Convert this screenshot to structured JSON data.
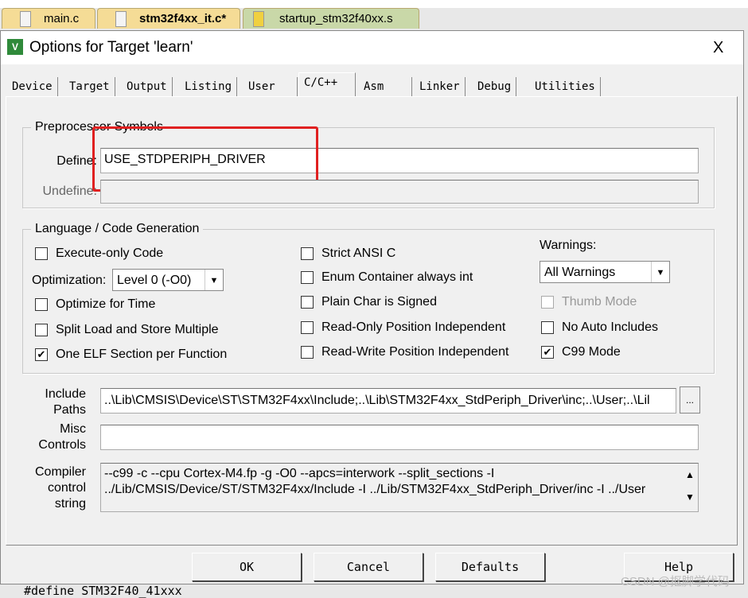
{
  "file_tabs": [
    {
      "label": "main.c",
      "color": "#f5dc96"
    },
    {
      "label": "stm32f4xx_it.c*",
      "color": "#f5dc96"
    },
    {
      "label": "startup_stm32f40xx.s",
      "color": "#c9d8a8"
    }
  ],
  "dialog": {
    "title": "Options for Target 'learn'",
    "close": "X"
  },
  "tabs": [
    "Device",
    "Target",
    "Output",
    "Listing",
    "User",
    "C/C++",
    "Asm",
    "Linker",
    "Debug",
    "Utilities"
  ],
  "active_tab": "C/C++",
  "preprocessor": {
    "legend": "Preprocessor Symbols",
    "define_label": "Define:",
    "define_value": "USE_STDPERIPH_DRIVER",
    "undefine_label": "Undefine:",
    "undefine_value": "",
    "highlight_color": "#e02020"
  },
  "codegen": {
    "legend": "Language / Code Generation",
    "execute_only": {
      "label": "Execute-only Code",
      "checked": false
    },
    "optimization_label": "Optimization:",
    "optimization_value": "Level 0 (-O0)",
    "optimize_time": {
      "label": "Optimize for Time",
      "checked": false
    },
    "split_load": {
      "label": "Split Load and Store Multiple",
      "checked": false
    },
    "one_elf": {
      "label": "One ELF Section per Function",
      "checked": true
    },
    "strict_ansi": {
      "label": "Strict ANSI C",
      "checked": false
    },
    "enum_container": {
      "label": "Enum Container always int",
      "checked": false
    },
    "plain_char": {
      "label": "Plain Char is Signed",
      "checked": false
    },
    "ro_pi": {
      "label": "Read-Only Position Independent",
      "checked": false
    },
    "rw_pi": {
      "label": "Read-Write Position Independent",
      "checked": false
    },
    "warnings_label": "Warnings:",
    "warnings_value": "All Warnings",
    "thumb_mode": {
      "label": "Thumb Mode",
      "checked": false,
      "disabled": true
    },
    "no_auto_includes": {
      "label": "No Auto Includes",
      "checked": false
    },
    "c99": {
      "label": "C99 Mode",
      "checked": true
    }
  },
  "include_paths": {
    "label1": "Include",
    "label2": "Paths",
    "value": "..\\Lib\\CMSIS\\Device\\ST\\STM32F4xx\\Include;..\\Lib\\STM32F4xx_StdPeriph_Driver\\inc;..\\User;..\\Lil",
    "browse": "..."
  },
  "misc_controls": {
    "label1": "Misc",
    "label2": "Controls",
    "value": ""
  },
  "compiler_string": {
    "label1": "Compiler",
    "label2": "control",
    "label3": "string",
    "line1": "--c99 -c --cpu Cortex-M4.fp -g -O0 --apcs=interwork --split_sections -I",
    "line2": "../Lib/CMSIS/Device/ST/STM32F4xx/Include -I ../Lib/STM32F4xx_StdPeriph_Driver/inc -I ../User"
  },
  "buttons": {
    "ok": "OK",
    "cancel": "Cancel",
    "defaults": "Defaults",
    "help": "Help"
  },
  "background_code": "#define STM32F40_41xxx",
  "watermark": "CSDN @抠脚学代码"
}
